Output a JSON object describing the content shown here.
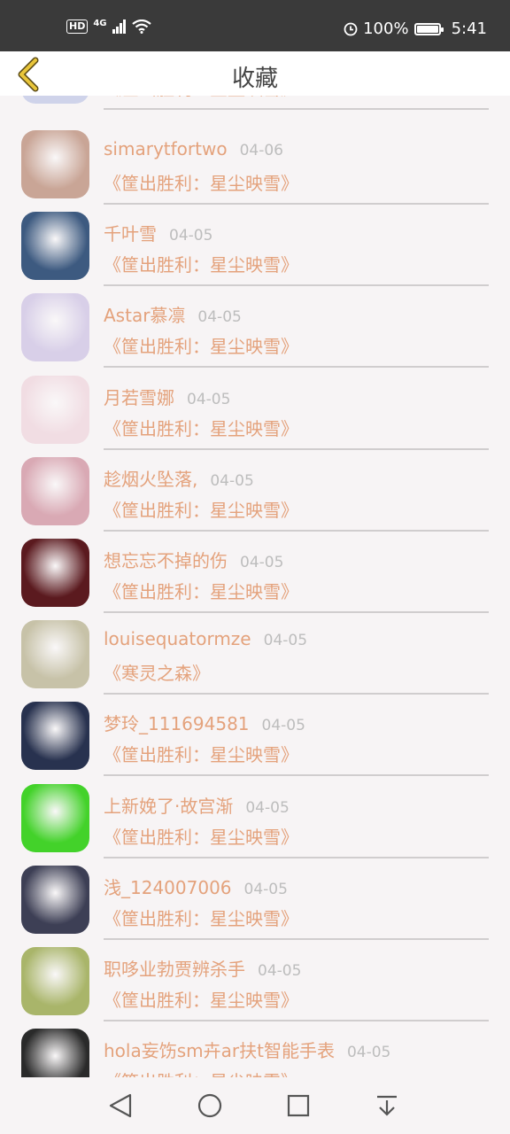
{
  "status_bar": {
    "hd": "HD",
    "network": "4G",
    "battery": "100%",
    "time": "5:41"
  },
  "header": {
    "title": "收藏"
  },
  "partial_top_item": {
    "book": "《筐出胜利：星尘映雪》"
  },
  "items": [
    {
      "name": "simarytfortwo",
      "date": "04-06",
      "book": "《筐出胜利：星尘映雪》",
      "avatar_color": "#c9a596"
    },
    {
      "name": "千叶雪",
      "date": "04-05",
      "book": "《筐出胜利：星尘映雪》",
      "avatar_color": "#3d5a80"
    },
    {
      "name": "Astar慕凛",
      "date": "04-05",
      "book": "《筐出胜利：星尘映雪》",
      "avatar_color": "#d8cfe8"
    },
    {
      "name": "月若雪娜",
      "date": "04-05",
      "book": "《筐出胜利：星尘映雪》",
      "avatar_color": "#f1dde3"
    },
    {
      "name": "趁烟火坠落,",
      "date": "04-05",
      "book": "《筐出胜利：星尘映雪》",
      "avatar_color": "#d9a9b4"
    },
    {
      "name": "想忘忘不掉的伤",
      "date": "04-05",
      "book": "《筐出胜利：星尘映雪》",
      "avatar_color": "#5b1a1f"
    },
    {
      "name": "louisequatormze",
      "date": "04-05",
      "book": "《寒灵之森》",
      "avatar_color": "#c7c2a8"
    },
    {
      "name": "梦玲_111694581",
      "date": "04-05",
      "book": "《筐出胜利：星尘映雪》",
      "avatar_color": "#28324f"
    },
    {
      "name": "上新娩了·故宫渐",
      "date": "04-05",
      "book": "《筐出胜利：星尘映雪》",
      "avatar_color": "#43d22a"
    },
    {
      "name": "浅_124007006",
      "date": "04-05",
      "book": "《筐出胜利：星尘映雪》",
      "avatar_color": "#3d3f55"
    },
    {
      "name": "职哆业勃贾辨杀手",
      "date": "04-05",
      "book": "《筐出胜利：星尘映雪》",
      "avatar_color": "#a9b56a"
    },
    {
      "name": "hola妄饬sm卉ar扶t智能手表",
      "date": "04-05",
      "book": "《筐出胜利：星尘映雪》",
      "avatar_color": "#2a2a2a"
    }
  ],
  "colors": {
    "accent": "#e4a27c",
    "back_arrow": "#c7a21a"
  }
}
